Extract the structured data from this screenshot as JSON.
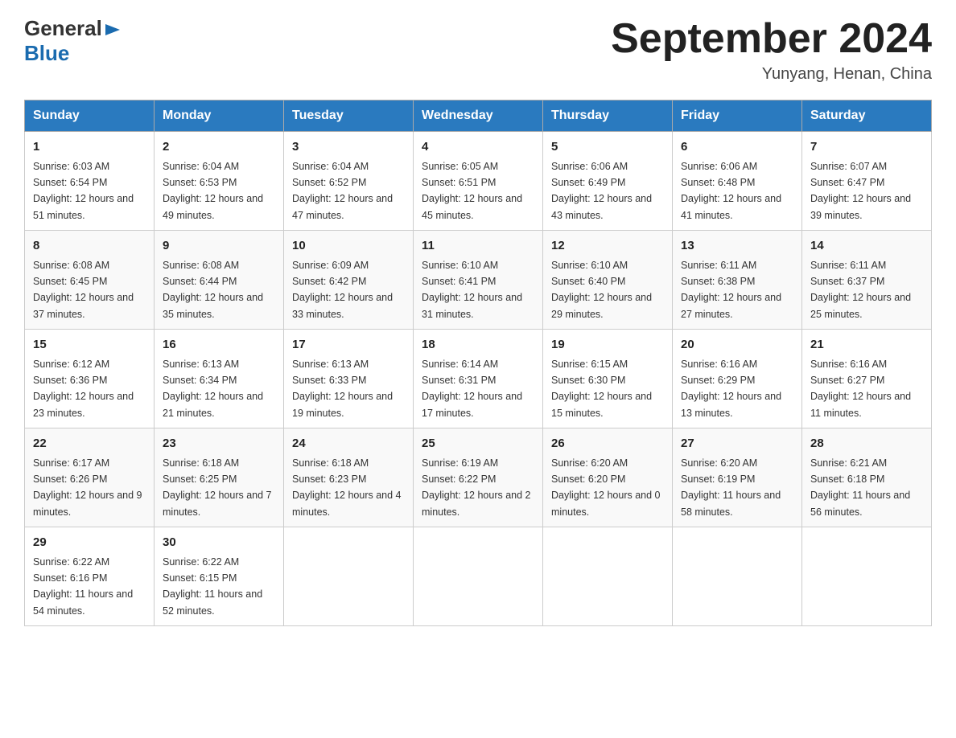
{
  "header": {
    "logo_general": "General",
    "logo_blue": "Blue",
    "title": "September 2024",
    "location": "Yunyang, Henan, China"
  },
  "columns": [
    "Sunday",
    "Monday",
    "Tuesday",
    "Wednesday",
    "Thursday",
    "Friday",
    "Saturday"
  ],
  "weeks": [
    [
      {
        "day": "1",
        "sunrise": "Sunrise: 6:03 AM",
        "sunset": "Sunset: 6:54 PM",
        "daylight": "Daylight: 12 hours and 51 minutes."
      },
      {
        "day": "2",
        "sunrise": "Sunrise: 6:04 AM",
        "sunset": "Sunset: 6:53 PM",
        "daylight": "Daylight: 12 hours and 49 minutes."
      },
      {
        "day": "3",
        "sunrise": "Sunrise: 6:04 AM",
        "sunset": "Sunset: 6:52 PM",
        "daylight": "Daylight: 12 hours and 47 minutes."
      },
      {
        "day": "4",
        "sunrise": "Sunrise: 6:05 AM",
        "sunset": "Sunset: 6:51 PM",
        "daylight": "Daylight: 12 hours and 45 minutes."
      },
      {
        "day": "5",
        "sunrise": "Sunrise: 6:06 AM",
        "sunset": "Sunset: 6:49 PM",
        "daylight": "Daylight: 12 hours and 43 minutes."
      },
      {
        "day": "6",
        "sunrise": "Sunrise: 6:06 AM",
        "sunset": "Sunset: 6:48 PM",
        "daylight": "Daylight: 12 hours and 41 minutes."
      },
      {
        "day": "7",
        "sunrise": "Sunrise: 6:07 AM",
        "sunset": "Sunset: 6:47 PM",
        "daylight": "Daylight: 12 hours and 39 minutes."
      }
    ],
    [
      {
        "day": "8",
        "sunrise": "Sunrise: 6:08 AM",
        "sunset": "Sunset: 6:45 PM",
        "daylight": "Daylight: 12 hours and 37 minutes."
      },
      {
        "day": "9",
        "sunrise": "Sunrise: 6:08 AM",
        "sunset": "Sunset: 6:44 PM",
        "daylight": "Daylight: 12 hours and 35 minutes."
      },
      {
        "day": "10",
        "sunrise": "Sunrise: 6:09 AM",
        "sunset": "Sunset: 6:42 PM",
        "daylight": "Daylight: 12 hours and 33 minutes."
      },
      {
        "day": "11",
        "sunrise": "Sunrise: 6:10 AM",
        "sunset": "Sunset: 6:41 PM",
        "daylight": "Daylight: 12 hours and 31 minutes."
      },
      {
        "day": "12",
        "sunrise": "Sunrise: 6:10 AM",
        "sunset": "Sunset: 6:40 PM",
        "daylight": "Daylight: 12 hours and 29 minutes."
      },
      {
        "day": "13",
        "sunrise": "Sunrise: 6:11 AM",
        "sunset": "Sunset: 6:38 PM",
        "daylight": "Daylight: 12 hours and 27 minutes."
      },
      {
        "day": "14",
        "sunrise": "Sunrise: 6:11 AM",
        "sunset": "Sunset: 6:37 PM",
        "daylight": "Daylight: 12 hours and 25 minutes."
      }
    ],
    [
      {
        "day": "15",
        "sunrise": "Sunrise: 6:12 AM",
        "sunset": "Sunset: 6:36 PM",
        "daylight": "Daylight: 12 hours and 23 minutes."
      },
      {
        "day": "16",
        "sunrise": "Sunrise: 6:13 AM",
        "sunset": "Sunset: 6:34 PM",
        "daylight": "Daylight: 12 hours and 21 minutes."
      },
      {
        "day": "17",
        "sunrise": "Sunrise: 6:13 AM",
        "sunset": "Sunset: 6:33 PM",
        "daylight": "Daylight: 12 hours and 19 minutes."
      },
      {
        "day": "18",
        "sunrise": "Sunrise: 6:14 AM",
        "sunset": "Sunset: 6:31 PM",
        "daylight": "Daylight: 12 hours and 17 minutes."
      },
      {
        "day": "19",
        "sunrise": "Sunrise: 6:15 AM",
        "sunset": "Sunset: 6:30 PM",
        "daylight": "Daylight: 12 hours and 15 minutes."
      },
      {
        "day": "20",
        "sunrise": "Sunrise: 6:16 AM",
        "sunset": "Sunset: 6:29 PM",
        "daylight": "Daylight: 12 hours and 13 minutes."
      },
      {
        "day": "21",
        "sunrise": "Sunrise: 6:16 AM",
        "sunset": "Sunset: 6:27 PM",
        "daylight": "Daylight: 12 hours and 11 minutes."
      }
    ],
    [
      {
        "day": "22",
        "sunrise": "Sunrise: 6:17 AM",
        "sunset": "Sunset: 6:26 PM",
        "daylight": "Daylight: 12 hours and 9 minutes."
      },
      {
        "day": "23",
        "sunrise": "Sunrise: 6:18 AM",
        "sunset": "Sunset: 6:25 PM",
        "daylight": "Daylight: 12 hours and 7 minutes."
      },
      {
        "day": "24",
        "sunrise": "Sunrise: 6:18 AM",
        "sunset": "Sunset: 6:23 PM",
        "daylight": "Daylight: 12 hours and 4 minutes."
      },
      {
        "day": "25",
        "sunrise": "Sunrise: 6:19 AM",
        "sunset": "Sunset: 6:22 PM",
        "daylight": "Daylight: 12 hours and 2 minutes."
      },
      {
        "day": "26",
        "sunrise": "Sunrise: 6:20 AM",
        "sunset": "Sunset: 6:20 PM",
        "daylight": "Daylight: 12 hours and 0 minutes."
      },
      {
        "day": "27",
        "sunrise": "Sunrise: 6:20 AM",
        "sunset": "Sunset: 6:19 PM",
        "daylight": "Daylight: 11 hours and 58 minutes."
      },
      {
        "day": "28",
        "sunrise": "Sunrise: 6:21 AM",
        "sunset": "Sunset: 6:18 PM",
        "daylight": "Daylight: 11 hours and 56 minutes."
      }
    ],
    [
      {
        "day": "29",
        "sunrise": "Sunrise: 6:22 AM",
        "sunset": "Sunset: 6:16 PM",
        "daylight": "Daylight: 11 hours and 54 minutes."
      },
      {
        "day": "30",
        "sunrise": "Sunrise: 6:22 AM",
        "sunset": "Sunset: 6:15 PM",
        "daylight": "Daylight: 11 hours and 52 minutes."
      },
      null,
      null,
      null,
      null,
      null
    ]
  ]
}
